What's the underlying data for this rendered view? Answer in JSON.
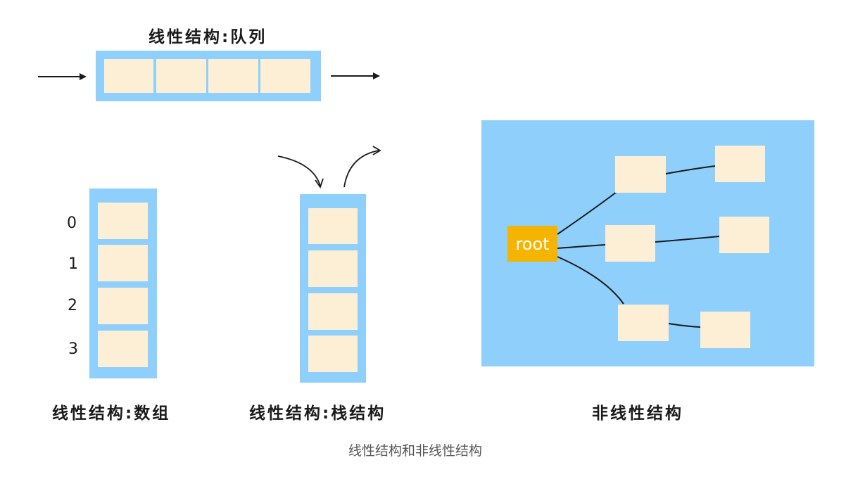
{
  "queue": {
    "title": "线性结构:队列",
    "cells": 4
  },
  "array": {
    "title": "线性结构:数组",
    "indices": [
      "0",
      "1",
      "2",
      "3"
    ]
  },
  "stack": {
    "title": "线性结构:栈结构",
    "cells": 4
  },
  "tree": {
    "title": "非线性结构",
    "root_label": "root",
    "child_nodes": 3,
    "leaf_nodes": 3
  },
  "caption": "线性结构和非线性结构",
  "colors": {
    "frame_blue": "#8ecffb",
    "cell_cream": "#fcefd5",
    "root_orange": "#f5b400",
    "ink": "#1a1a1a"
  }
}
